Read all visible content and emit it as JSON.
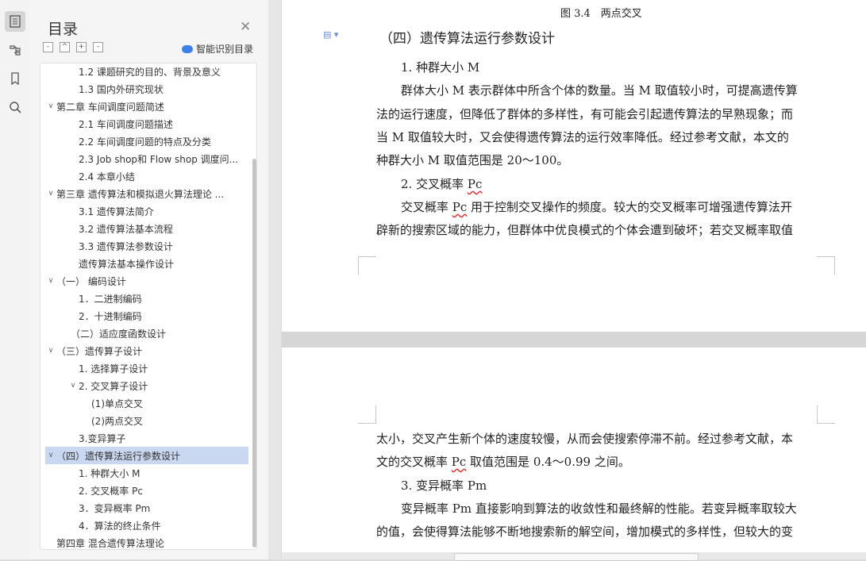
{
  "sidebar": {
    "title": "目录",
    "ai_detect": "智能识别目录",
    "tools": [
      "-",
      "^",
      "+",
      "-"
    ],
    "items": [
      {
        "label": "1.2 课题研究的目的、背景及意义",
        "level": 2,
        "chevron": ""
      },
      {
        "label": "1.3 国内外研究现状",
        "level": 2,
        "chevron": ""
      },
      {
        "label": "第二章 车间调度问题简述",
        "level": 1,
        "chevron": "∨"
      },
      {
        "label": "2.1 车间调度问题描述",
        "level": 2,
        "chevron": ""
      },
      {
        "label": "2.2 车间调度问题的特点及分类",
        "level": 2,
        "chevron": ""
      },
      {
        "label": "2.3 Job shop和 Flow shop 调度问...",
        "level": 2,
        "chevron": ""
      },
      {
        "label": "2.4 本章小结",
        "level": 2,
        "chevron": ""
      },
      {
        "label": "第三章 遗传算法和模拟退火算法理论 ...",
        "level": 1,
        "chevron": "∨"
      },
      {
        "label": "3.1 遗传算法简介",
        "level": 2,
        "chevron": ""
      },
      {
        "label": "3.2 遗传算法基本流程",
        "level": 2,
        "chevron": ""
      },
      {
        "label": "3.3 遗传算法参数设计",
        "level": 2,
        "chevron": ""
      },
      {
        "label": "遗传算法基本操作设计",
        "level": 2,
        "chevron": ""
      },
      {
        "label": "（一） 编码设计",
        "level": 1,
        "chevron": "∨"
      },
      {
        "label": "1．二进制编码",
        "level": 2,
        "chevron": ""
      },
      {
        "label": "2．十进制编码",
        "level": 2,
        "chevron": ""
      },
      {
        "label": "（二）适应度函数设计",
        "level": 1.5,
        "chevron": ""
      },
      {
        "label": "（三）遗传算子设计",
        "level": 1,
        "chevron": "∨"
      },
      {
        "label": "1. 选择算子设计",
        "level": 2,
        "chevron": ""
      },
      {
        "label": "2. 交叉算子设计",
        "level": 2,
        "chevron": "∨"
      },
      {
        "label": "(1)单点交叉",
        "level": 3,
        "chevron": ""
      },
      {
        "label": "(2)两点交叉",
        "level": 3,
        "chevron": ""
      },
      {
        "label": "3.变异算子",
        "level": 2,
        "chevron": ""
      },
      {
        "label": "（四）遗传算法运行参数设计",
        "level": 1,
        "chevron": "∨",
        "selected": true
      },
      {
        "label": "1. 种群大小 M",
        "level": 2,
        "chevron": ""
      },
      {
        "label": "2. 交叉概率 Pc",
        "level": 2,
        "chevron": ""
      },
      {
        "label": "3．变异概率 Pm",
        "level": 2,
        "chevron": ""
      },
      {
        "label": "4．算法的终止条件",
        "level": 2,
        "chevron": ""
      },
      {
        "label": "第四章 混合遗传算法理论",
        "level": 1,
        "chevron": ""
      }
    ]
  },
  "doc": {
    "fig_caption": "图 3.4　两点交叉",
    "heading": "（四）遗传算法运行参数设计",
    "sub1": "1. 种群大小 M",
    "p1_lines": [
      "群体大小 M 表示群体中所含个体的数量。当 M 取值较小时，可提高遗传算",
      "法的运行速度，但降低了群体的多样性，有可能会引起遗传算法的早熟现象；而",
      "当 M 取值较大时，又会使得遗传算法的运行效率降低。经过参考文献，本文的",
      "种群大小 M 取值范围是 20～100。"
    ],
    "sub2_prefix": "2. 交叉概率 ",
    "sub2_term": "Pc",
    "p2_line1_a": "交叉概率 ",
    "p2_line1_term": "Pc",
    "p2_line1_b": " 用于控制交叉操作的频度。较大的交叉概率可增强遗传算法开",
    "p2_line2": "辟新的搜索区域的能力，但群体中优良模式的个体会遭到破坏；若交叉概率取值",
    "p3_line1": "太小，交叉产生新个体的速度较慢，从而会使搜索停滞不前。经过参考文献，本",
    "p3_line2_a": "文的交叉概率 ",
    "p3_line2_term": "Pc",
    "p3_line2_b": " 取值范围是 0.4～0.99 之间。",
    "sub3": "3. 变异概率 Pm",
    "p4_line1": "变异概率 Pm 直接影响到算法的收敛性和最终解的性能。若变异概率取较大",
    "p4_line2": "的值，会使得算法能够不断地搜索新的解空间，增加模式的多样性，但较大的变"
  },
  "colors": {
    "selected": "#cad7f0",
    "accent": "#3f7fe8"
  }
}
